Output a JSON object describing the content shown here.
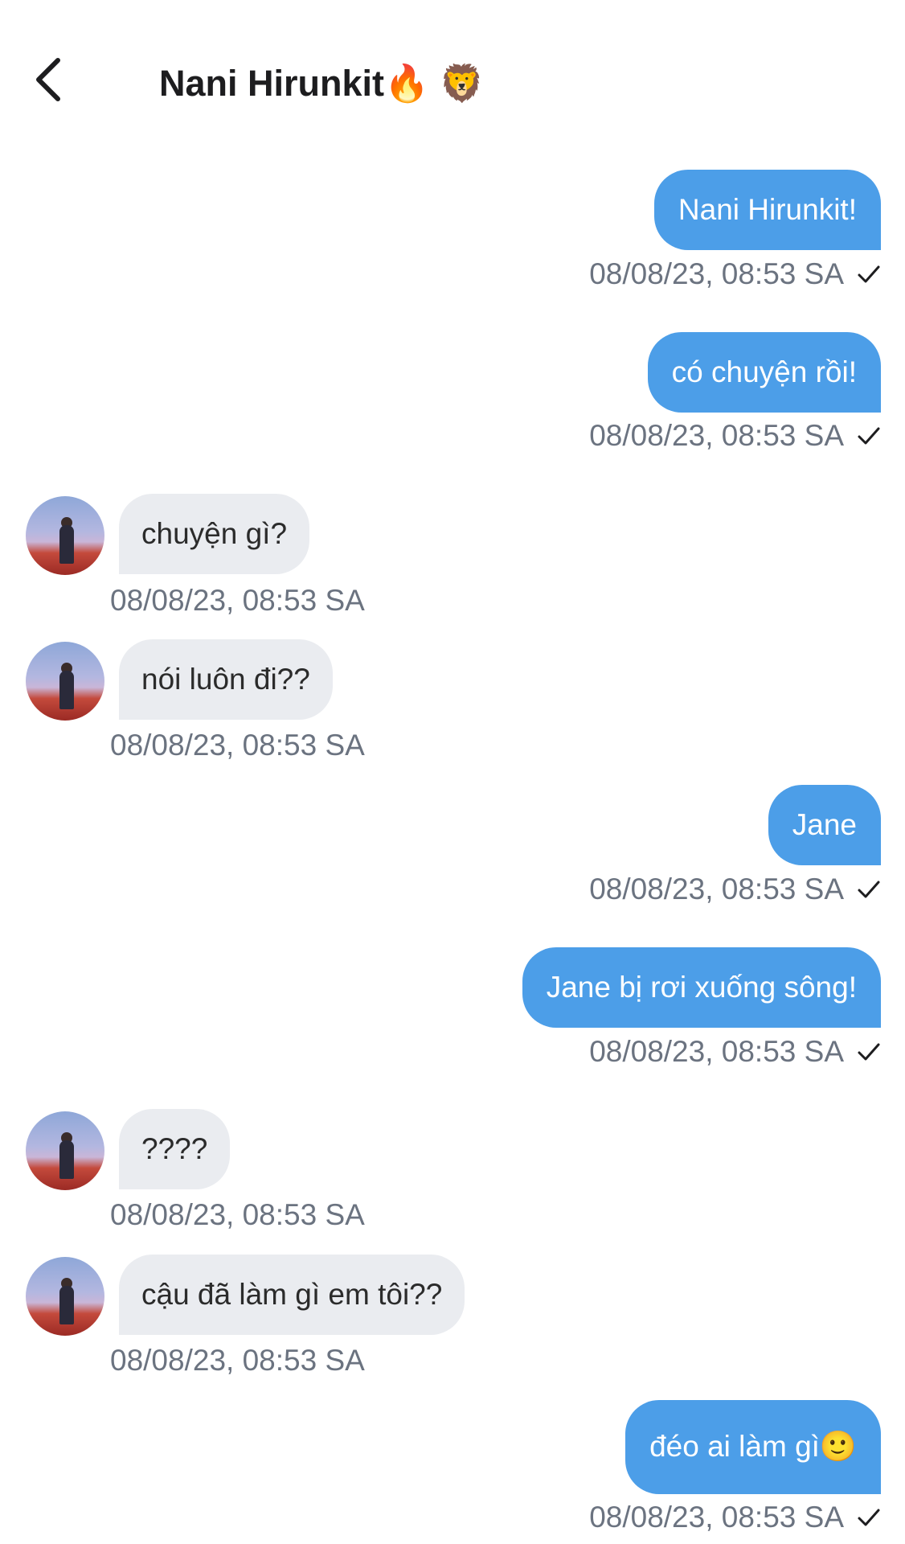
{
  "header": {
    "title": "Nani Hirunkit",
    "title_emoji": "🔥 🦁"
  },
  "colors": {
    "outgoing_bubble": "#4c9ee8",
    "incoming_bubble": "#eaecf0",
    "timestamp": "#6b7380"
  },
  "icons": {
    "back": "chevron-left-icon",
    "sent": "check-icon"
  },
  "messages": [
    {
      "direction": "out",
      "text": "Nani Hirunkit!",
      "time": "08/08/23, 08:53 SA"
    },
    {
      "direction": "out",
      "text": "có chuyện rồi!",
      "time": "08/08/23, 08:53 SA"
    },
    {
      "direction": "in",
      "text": "chuyện gì?",
      "time": "08/08/23, 08:53 SA"
    },
    {
      "direction": "in",
      "text": "nói luôn đi??",
      "time": "08/08/23, 08:53 SA"
    },
    {
      "direction": "out",
      "text": "Jane",
      "time": "08/08/23, 08:53 SA"
    },
    {
      "direction": "out",
      "text": "Jane bị rơi xuống sông!",
      "time": "08/08/23, 08:53 SA"
    },
    {
      "direction": "in",
      "text": "????",
      "time": "08/08/23, 08:53 SA"
    },
    {
      "direction": "in",
      "text": "cậu đã làm gì em tôi??",
      "time": "08/08/23, 08:53 SA"
    },
    {
      "direction": "out",
      "text": "đéo ai làm gì🙂",
      "time": "08/08/23, 08:53 SA"
    }
  ]
}
